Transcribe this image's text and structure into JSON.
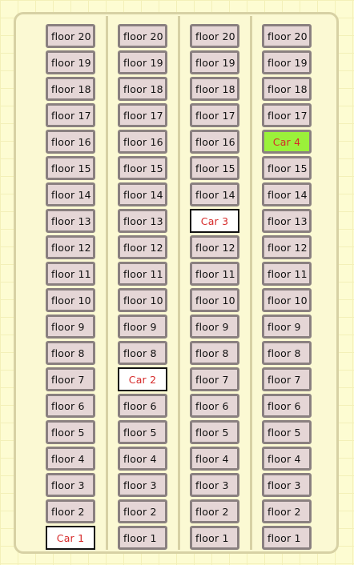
{
  "columns": [
    {
      "id": "elevator-1",
      "cells": [
        "floor 20",
        "floor 19",
        "floor 18",
        "floor 17",
        "floor 16",
        "floor 15",
        "floor 14",
        "floor 13",
        "floor 12",
        "floor 11",
        "floor 10",
        "floor 9",
        "floor 8",
        "floor 7",
        "floor 6",
        "floor 5",
        "floor 4",
        "floor 3",
        "floor 2",
        "Car 1"
      ],
      "car_floor": 1,
      "car_active": false
    },
    {
      "id": "elevator-2",
      "cells": [
        "floor 20",
        "floor 19",
        "floor 18",
        "floor 17",
        "floor 16",
        "floor 15",
        "floor 14",
        "floor 13",
        "floor 12",
        "floor 11",
        "floor 10",
        "floor 9",
        "floor 8",
        "Car 2",
        "floor 6",
        "floor 5",
        "floor 4",
        "floor 3",
        "floor 2",
        "floor 1"
      ],
      "car_floor": 7,
      "car_active": false
    },
    {
      "id": "elevator-3",
      "cells": [
        "floor 20",
        "floor 19",
        "floor 18",
        "floor 17",
        "floor 16",
        "floor 15",
        "floor 14",
        "Car 3",
        "floor 12",
        "floor 11",
        "floor 10",
        "floor 9",
        "floor 8",
        "floor 7",
        "floor 6",
        "floor 5",
        "floor 4",
        "floor 3",
        "floor 2",
        "floor 1"
      ],
      "car_floor": 13,
      "car_active": false
    },
    {
      "id": "elevator-4",
      "cells": [
        "floor 20",
        "floor 19",
        "floor 18",
        "floor 17",
        "Car 4",
        "floor 15",
        "floor 14",
        "floor 13",
        "floor 12",
        "floor 11",
        "floor 10",
        "floor 9",
        "floor 8",
        "floor 7",
        "floor 6",
        "floor 5",
        "floor 4",
        "floor 3",
        "floor 2",
        "floor 1"
      ],
      "car_floor": 16,
      "car_active": true
    }
  ],
  "colors": {
    "background": "#fdfcd2",
    "panel_border": "#d7d1a4",
    "cell_bg": "#e5d6d6",
    "cell_border": "#8a8080",
    "car_text": "#d62a2a",
    "car_active_bg": "#9bf13a"
  }
}
